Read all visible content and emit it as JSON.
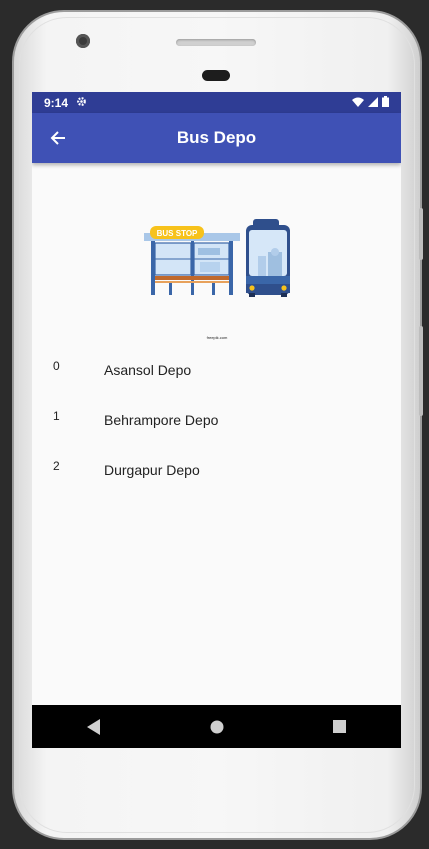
{
  "status_bar": {
    "time": "9:14",
    "icons": [
      "settings-gear-icon",
      "wifi-icon",
      "signal-icon",
      "battery-icon"
    ]
  },
  "app_bar": {
    "title": "Bus Depo",
    "back_icon": "arrow-back-icon",
    "color": "#3f51b5"
  },
  "illustration": {
    "sign_text": "BUS STOP",
    "credit": "freepik.com"
  },
  "depots": [
    {
      "index": "0",
      "name": "Asansol Depo"
    },
    {
      "index": "1",
      "name": "Behrampore Depo"
    },
    {
      "index": "2",
      "name": "Durgapur Depo"
    }
  ],
  "nav_bar": {
    "buttons": [
      "back-triangle-icon",
      "home-circle-icon",
      "recents-square-icon"
    ]
  }
}
